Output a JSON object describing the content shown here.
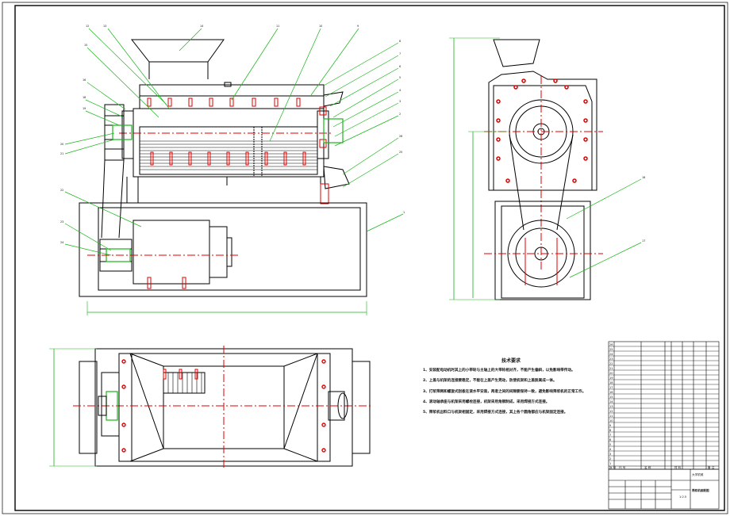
{
  "drawing": {
    "tech_notes": {
      "title": "技术要求",
      "items": [
        "1、安装配电动机时其上的小带轮与主轴上的大带轮相对齐，不能产生偏斜，以免影响带传动。",
        "2、上盖与机架的连接要稳定，不能在上盖产生晃动，防使机架和上盖脱离成一体。",
        "3、打浆筛网和螺旋式刮板在滚水平安装，两者之间的间隙要保持一致，避免影响筛浆机的正常工作。",
        "4、滚动轴承座与机架采用螺栓连接，机架采用角钢制成，采用焊接方式连接。",
        "5、筛浆机出料口与机架相固定，采用焊接方式连接，其上各个圆角都应与机架固定连接。"
      ]
    },
    "title_block": {
      "drawing_name": "筛浆机装配图",
      "col_seq": "序 号",
      "col_code": "代 号",
      "col_name": "名 称",
      "col_material": "材 料",
      "col_remark": "备 注",
      "stamp": "大学机械",
      "scale": "1:2.5"
    }
  }
}
